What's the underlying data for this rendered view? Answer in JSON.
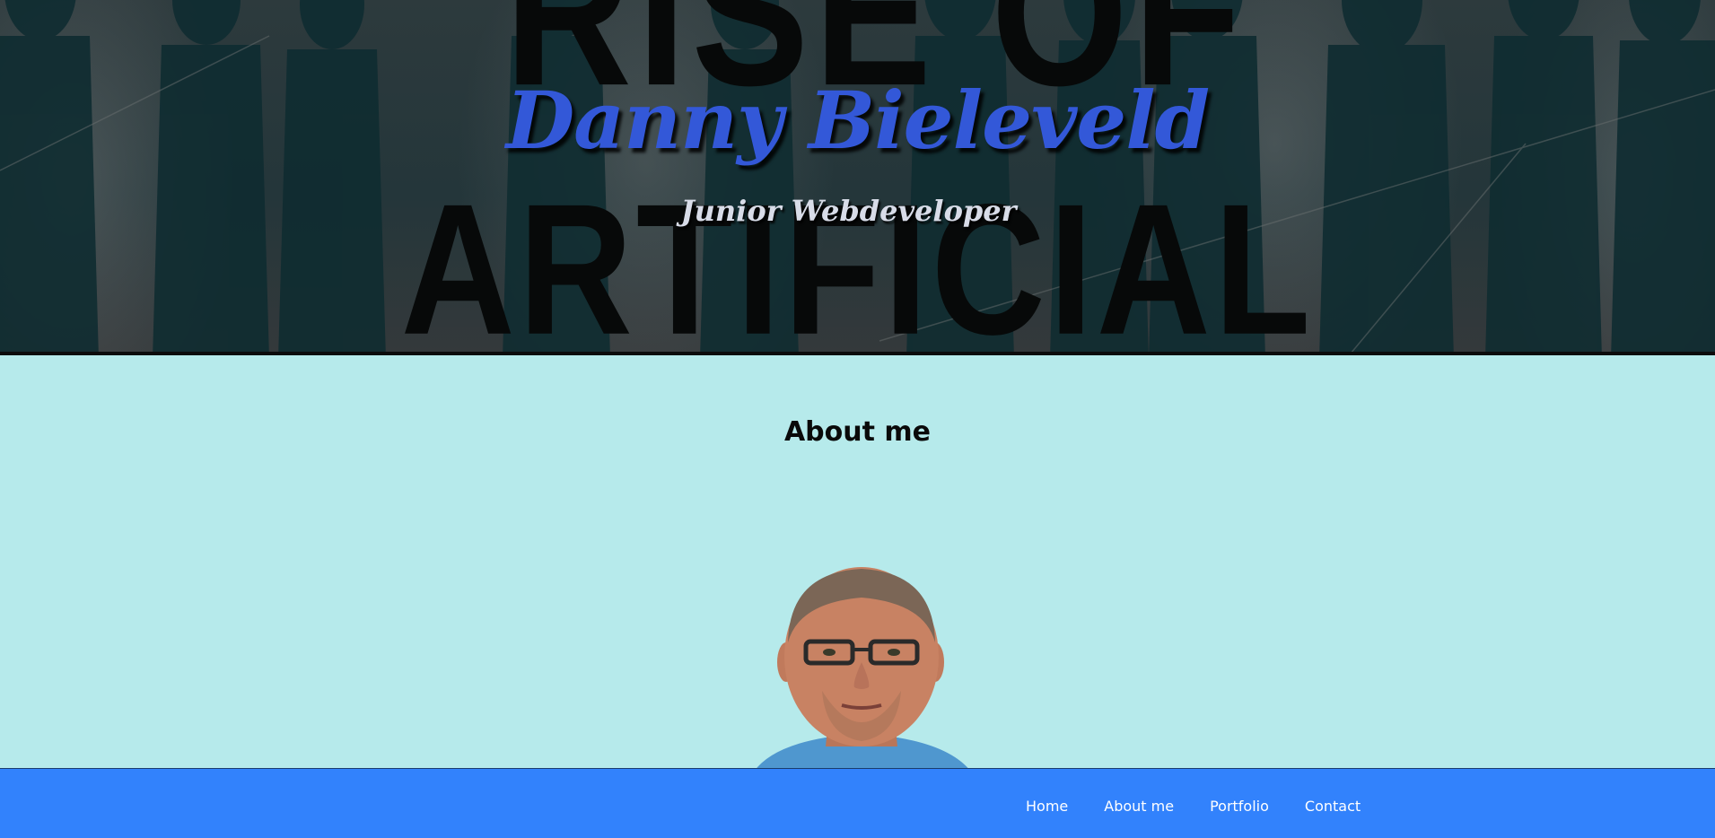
{
  "hero": {
    "background_words": {
      "top": "RISE OF",
      "bottom": "ARTIFICIAL"
    },
    "title": "Danny Bieleveld",
    "subtitle": "Junior Webdeveloper"
  },
  "about": {
    "heading": "About me"
  },
  "nav": {
    "items": [
      {
        "label": "Home"
      },
      {
        "label": "About me"
      },
      {
        "label": "Portfolio"
      },
      {
        "label": "Contact"
      }
    ]
  },
  "colors": {
    "title": "#3358d8",
    "subtitle": "#d8dce8",
    "about_bg": "#b6eaeb",
    "nav_bg": "#3282fc",
    "nav_text": "#ffffff"
  }
}
